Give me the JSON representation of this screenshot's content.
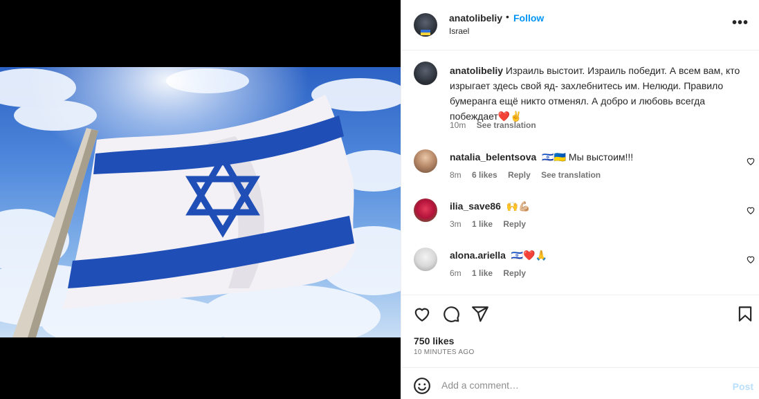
{
  "post": {
    "author": "anatolibeliy",
    "separator": "•",
    "follow_label": "Follow",
    "location": "Israel",
    "more_label": "•••",
    "image_icon": "israel-flag-photo"
  },
  "caption": {
    "username": "anatolibeliy",
    "text": "Израиль выстоит. Израиль победит. А всем вам, кто изрыгает здесь свой яд- захлебнитесь им. Нелюди. Правило бумеранга ещё никто отменял. А добро и любовь всегда побеждает❤️✌️",
    "time": "10m",
    "see_translation": "See translation"
  },
  "comments": [
    {
      "username": "natalia_belentsova",
      "text": "🇮🇱🇺🇦 Мы выстоим!!!",
      "time": "8m",
      "likes": "6 likes",
      "reply": "Reply",
      "see_translation": "See translation"
    },
    {
      "username": "ilia_save86",
      "text": "🙌💪🏼",
      "time": "3m",
      "likes": "1 like",
      "reply": "Reply"
    },
    {
      "username": "alona.ariella",
      "text": "🇮🇱❤️🙏",
      "time": "6m",
      "likes": "1 like",
      "reply": "Reply"
    }
  ],
  "stats": {
    "likes": "750 likes",
    "posted": "10 MINUTES AGO"
  },
  "add_comment": {
    "placeholder": "Add a comment…",
    "post_label": "Post"
  },
  "colors": {
    "accent": "#0095f6",
    "post_disabled": "#b9dffc",
    "secondary_text": "#737373",
    "flag_blue": "#1f4fb6"
  }
}
